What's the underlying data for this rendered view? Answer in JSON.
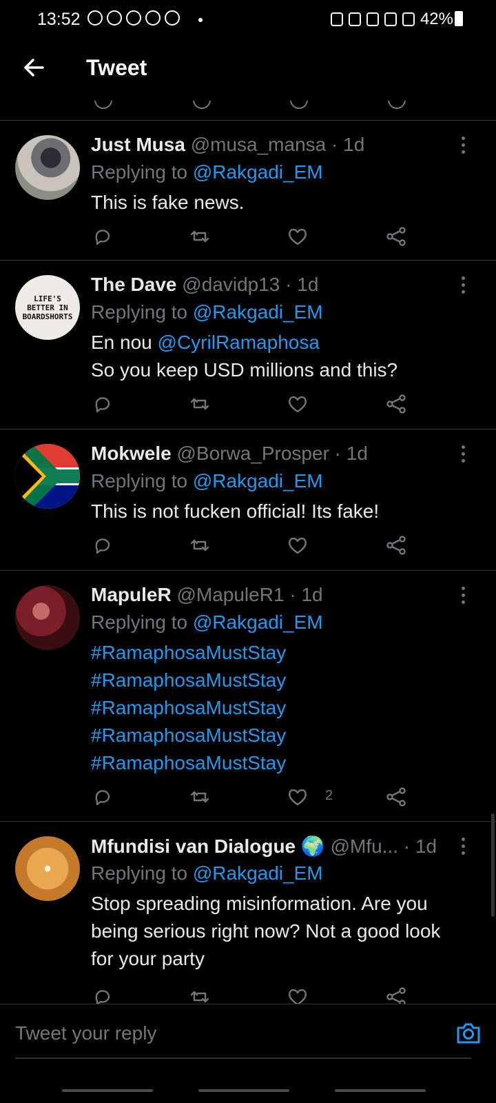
{
  "status": {
    "time": "13:52",
    "battery": "42%"
  },
  "header": {
    "title": "Tweet"
  },
  "tweets": [
    {
      "name": "Just Musa",
      "handle": "@musa_mansa",
      "time": "· 1d",
      "replying_prefix": "Replying to",
      "replying_to": "@Rakgadi_EM",
      "lines": [
        [
          "This is fake news."
        ]
      ],
      "likes": ""
    },
    {
      "name": "The Dave",
      "handle": "@davidp13",
      "time": "· 1d",
      "replying_prefix": "Replying to",
      "replying_to": "@Rakgadi_EM",
      "text_prefix": "En nou",
      "mention": "@CyrilRamaphosa",
      "text_line2": "So you keep USD millions and this?",
      "avatar_text": "LIFE'S BETTER IN BOARDSHORTS",
      "likes": ""
    },
    {
      "name": "Mokwele",
      "handle": "@Borwa_Prosper",
      "time": "· 1d",
      "replying_prefix": "Replying to",
      "replying_to": "@Rakgadi_EM",
      "text": "This is not fucken official! Its fake!",
      "likes": ""
    },
    {
      "name": "MapuleR",
      "handle": "@MapuleR1",
      "time": "· 1d",
      "replying_prefix": "Replying to",
      "replying_to": "@Rakgadi_EM",
      "hashtags": [
        "#RamaphosaMustStay",
        "#RamaphosaMustStay",
        "#RamaphosaMustStay",
        "#RamaphosaMustStay",
        "#RamaphosaMustStay"
      ],
      "likes": "2"
    },
    {
      "name": "Mfundisi van Dialogue",
      "name_emoji": "🌍",
      "handle": "@Mfu...",
      "time": "· 1d",
      "replying_prefix": "Replying to",
      "replying_to": "@Rakgadi_EM",
      "text_lines": [
        "Stop spreading misinformation. Are you",
        "being serious right now? Not a good look",
        "for your party"
      ],
      "likes": ""
    }
  ],
  "compose": {
    "placeholder": "Tweet your reply"
  },
  "colors": {
    "accent": "#1d9bf0",
    "muted": "#71767b",
    "background": "#000000"
  }
}
